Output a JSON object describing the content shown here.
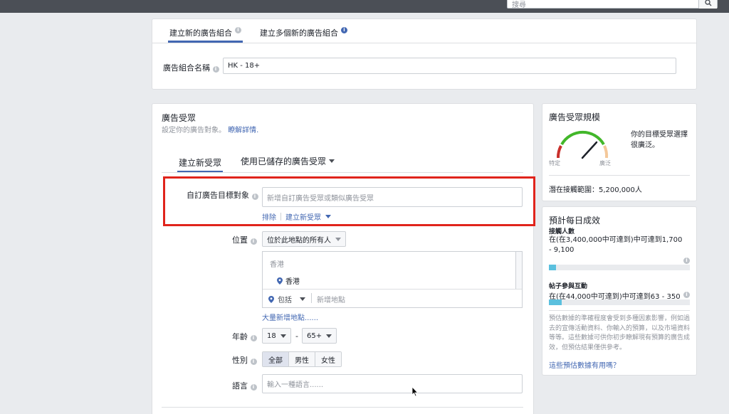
{
  "header": {
    "search_placeholder": "搜尋"
  },
  "top_panel": {
    "tabs": [
      {
        "label": "建立新的廣告組合",
        "active": true
      },
      {
        "label": "建立多個新的廣告組合",
        "active": false
      }
    ],
    "adset_name_label": "廣告組合名稱",
    "adset_name_value": "HK - 18+"
  },
  "audience": {
    "title": "廣告受眾",
    "subtitle": "設定你的廣告對象。",
    "learn_more": "瞭解詳情.",
    "tabs": [
      {
        "label": "建立新受眾",
        "active": true
      },
      {
        "label": "使用已儲存的廣告受眾",
        "active": false
      }
    ],
    "custom_label": "自訂廣告目標對象",
    "custom_placeholder": "新增自訂廣告受眾或類似廣告受眾",
    "exclude_link": "排除",
    "create_new_link": "建立新受眾",
    "location_label": "位置",
    "location_dropdown": "位於此地點的所有人",
    "location_region_header": "香港",
    "location_item": "香港",
    "include_label": "包括",
    "add_location_placeholder": "新增地點",
    "bulk_add_link": "大量新增地點......",
    "age_label": "年齡",
    "age_min": "18",
    "age_dash": "-",
    "age_max": "65+",
    "gender_label": "性別",
    "gender_options": [
      "全部",
      "男性",
      "女性"
    ],
    "gender_selected": "全部",
    "language_label": "語言",
    "language_placeholder": "輸入一種語言......"
  },
  "audience_size": {
    "title": "廣告受眾規模",
    "gauge_left": "特定",
    "gauge_right": "廣泛",
    "description": "你的目標受眾選擇很廣泛。",
    "potential_reach": "潛在接觸範圍：5,200,000人",
    "gauge_level": 0.82
  },
  "daily_results": {
    "title": "預計每日成效",
    "reach_label": "接觸人數",
    "reach_value": "在(在3,400,000中可達到)中可達到1,700 - 9,100",
    "reach_fill": 0.05,
    "engagement_label": "帖子參與互動",
    "engagement_value": "在(在44,000中可達到)中可達到63 - 350",
    "engagement_fill": 0.09,
    "disclaimer": "預估數據的準確程度會受到多種因素影響，例如過去的宣傳活動資料、你輸入的預算，以及市場資料等等。這些數據可供你初步瞭解現有預算的廣告成效，但預估結果僅供參考。",
    "helpful_link": "這些預估數據有用嗎？"
  },
  "colors": {
    "accent": "#4267b2",
    "highlight": "#e0241c",
    "bar": "#5bc0de"
  }
}
